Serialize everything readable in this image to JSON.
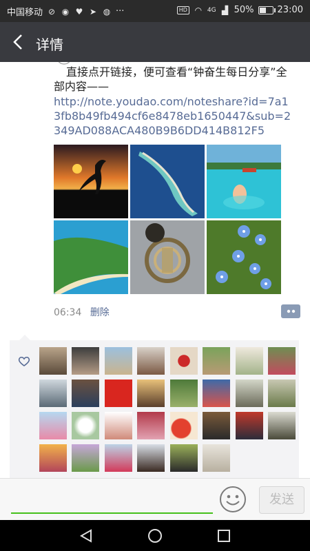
{
  "status_bar": {
    "carrier": "中国移动",
    "hd_label": "HD",
    "network": "4G",
    "battery_percent": 50,
    "battery_text": "50%",
    "time": "23:00",
    "more": "···"
  },
  "header": {
    "title": "详情"
  },
  "post": {
    "text": "直接点开链接，便可查看“钟奋生每日分享”全部内容——",
    "link": "http://note.youdao.com/noteshare?id=7a13fb8b49fb494cf6e8478eb1650447&sub=2349AD088ACA480B9B6DD414B812F5",
    "time": "06:34",
    "delete_label": "删除"
  },
  "input": {
    "send_label": "发送"
  },
  "colors": {
    "link": "#576b95",
    "accent_green": "#45c01a",
    "title_bar": "#393a3f"
  },
  "icons": {
    "back": "back-arrow-icon",
    "comment": "comment-bubble-icon",
    "like": "heart-icon",
    "emoji": "emoji-face-icon",
    "nav_back": "nav-back-triangle-icon",
    "nav_home": "nav-home-circle-icon",
    "nav_recent": "nav-recent-square-icon"
  }
}
